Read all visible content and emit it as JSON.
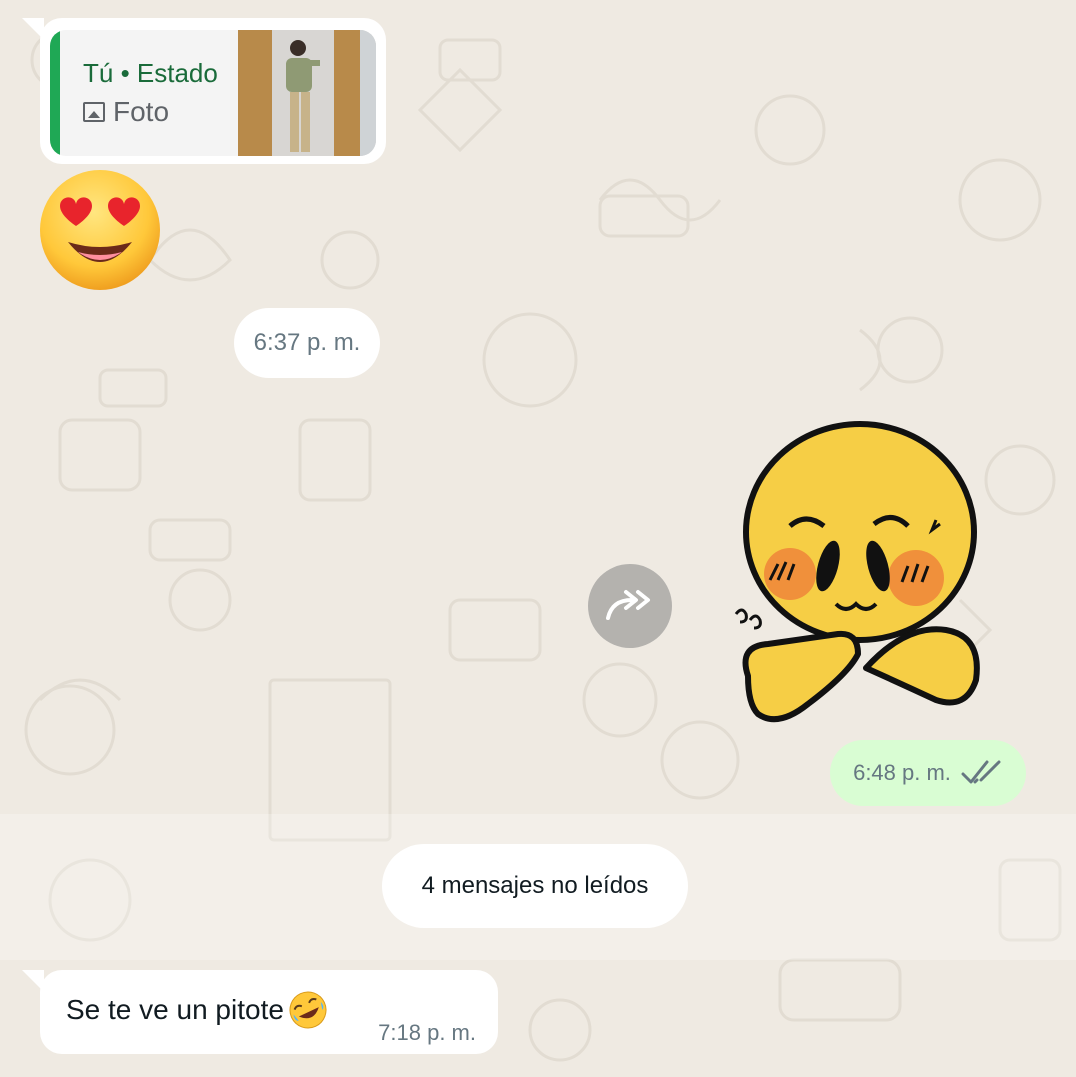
{
  "chat": {
    "reply": {
      "author": "Tú • Estado",
      "type_label": "Foto",
      "thumbnail_icon": "status-photo-thumbnail"
    },
    "emoji_reaction": "heart-eyes-emoji",
    "time_divider": "6:37 p. m.",
    "sticker": "blushing-emoji-sticker",
    "outgoing_time": "6:48 p. m.",
    "read_receipt_icon": "double-check-icon",
    "unread_divider": "4 mensajes no leídos",
    "incoming_message": {
      "text": "Se te ve un pitote",
      "emoji": "rolling-laughing-emoji",
      "time": "7:18 p. m."
    }
  },
  "colors": {
    "wallpaper": "#efeae2",
    "incoming_bubble": "#ffffff",
    "outgoing_bubble": "#d9fdd3",
    "accent": "#1fa855",
    "time_text": "#667781"
  }
}
